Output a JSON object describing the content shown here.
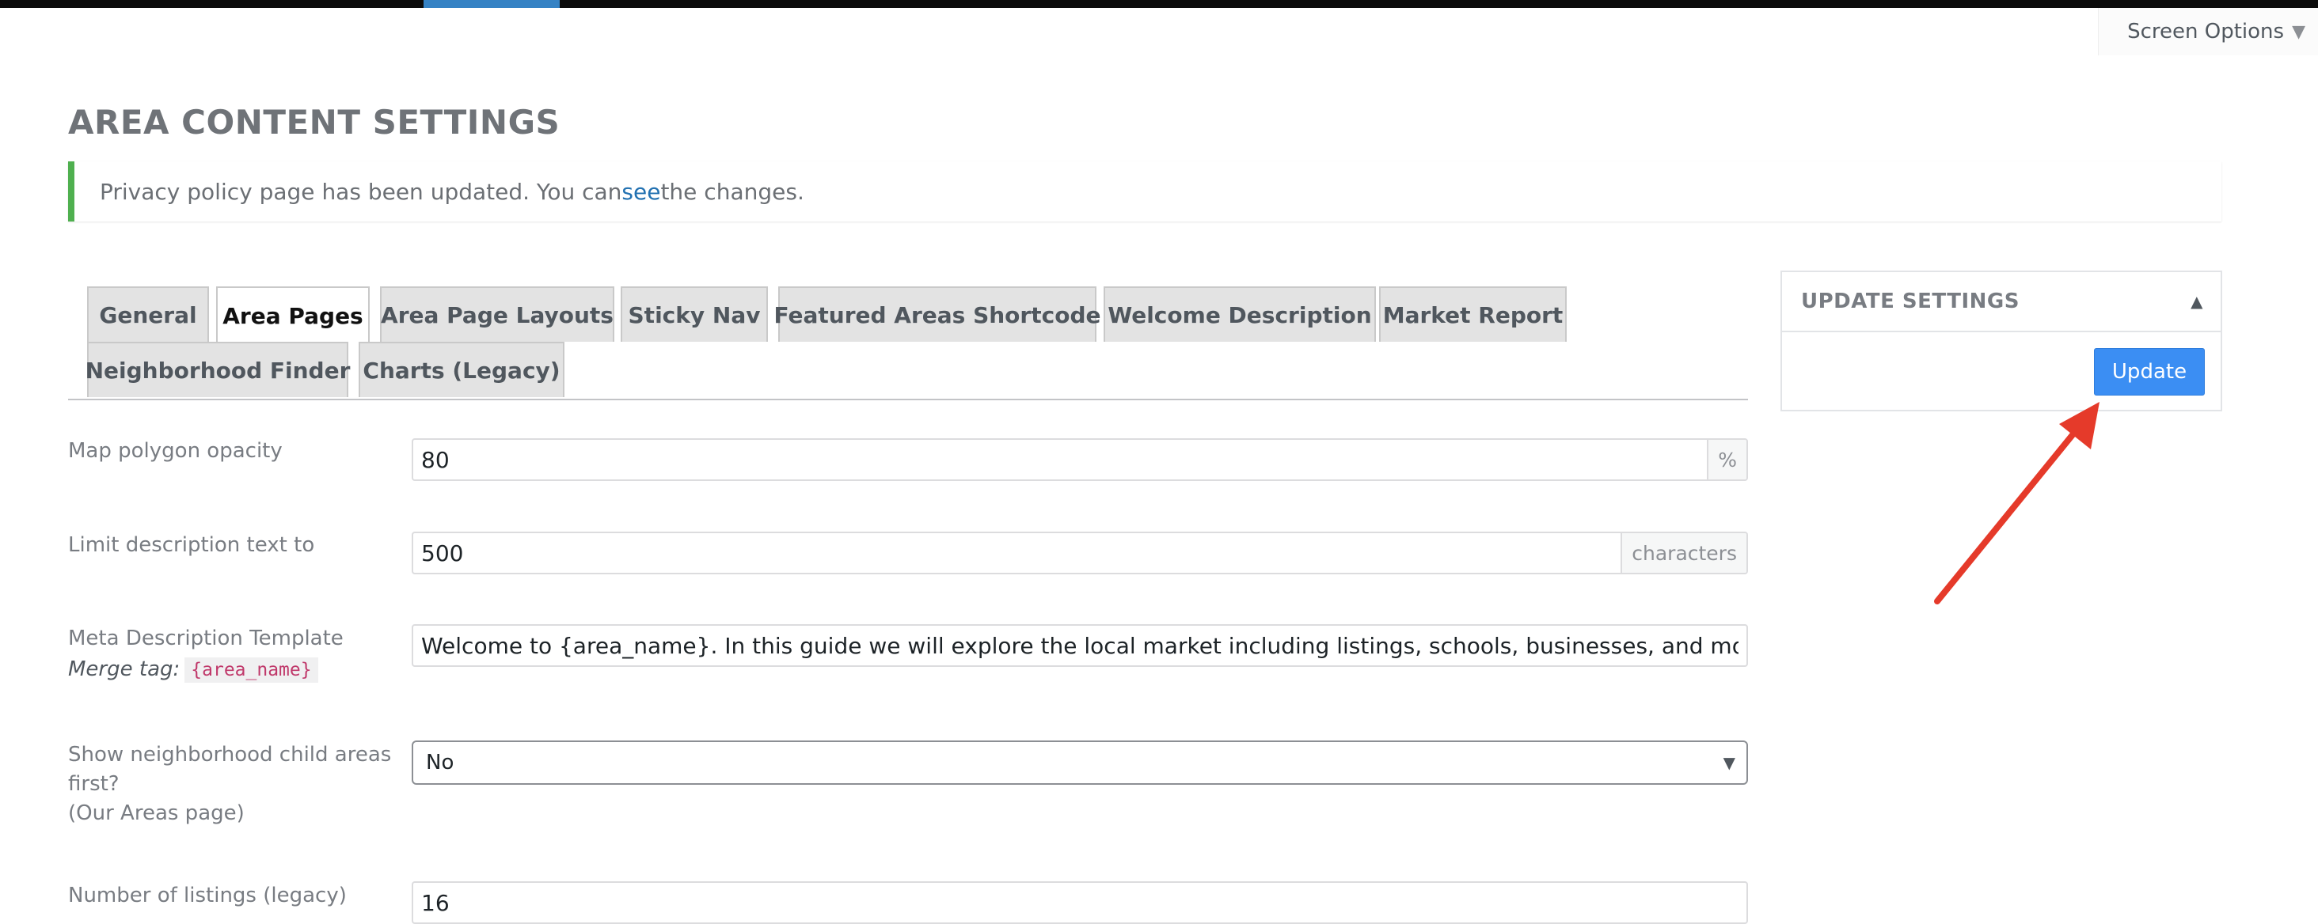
{
  "header": {
    "screen_options_label": "Screen Options"
  },
  "page": {
    "title": "AREA CONTENT SETTINGS"
  },
  "notice": {
    "text_before": "Privacy policy page has been updated. You can ",
    "link_text": "see",
    "text_after": " the changes."
  },
  "tabs": [
    {
      "label": "General",
      "active": false
    },
    {
      "label": "Area Pages",
      "active": true
    },
    {
      "label": "Area Page Layouts",
      "active": false
    },
    {
      "label": "Sticky Nav",
      "active": false
    },
    {
      "label": "Featured Areas Shortcode",
      "active": false
    },
    {
      "label": "Welcome Description",
      "active": false
    },
    {
      "label": "Market Report",
      "active": false
    },
    {
      "label": "Neighborhood Finder",
      "active": false
    },
    {
      "label": "Charts (Legacy)",
      "active": false
    }
  ],
  "form": {
    "map_opacity": {
      "label": "Map polygon opacity",
      "value": "80",
      "suffix": "%"
    },
    "limit_description": {
      "label": "Limit description text to",
      "value": "500",
      "suffix": "characters"
    },
    "meta_description": {
      "label": "Meta Description Template",
      "merge_label": "Merge tag:",
      "merge_tag": "{area_name}",
      "value": "Welcome to {area_name}. In this guide we will explore the local market including listings, schools, businesses, and more."
    },
    "show_child_areas": {
      "label_line1": "Show neighborhood child areas",
      "label_line2": "first?",
      "label_line3": "(Our Areas page)",
      "value": "No"
    },
    "number_of_listings": {
      "label": "Number of listings (legacy)",
      "value": "16"
    }
  },
  "sidebar": {
    "title": "UPDATE SETTINGS",
    "update_label": "Update"
  },
  "colors": {
    "accent": "#3b8ef3",
    "notice_border": "#4fb04f",
    "annotation_arrow": "#e53a2a",
    "link": "#2271b1"
  }
}
